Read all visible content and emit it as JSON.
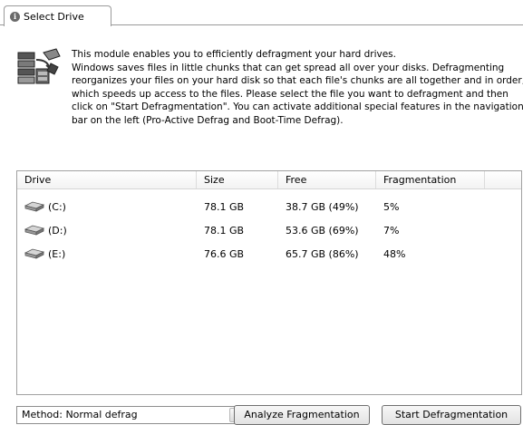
{
  "tab": {
    "label": "Select Drive",
    "icon": "info-icon"
  },
  "intro": {
    "icon": "defrag-module-icon",
    "lines": [
      "This module enables you to efficiently defragment your hard drives.",
      "Windows saves files in little chunks that can get spread all over your disks. Defragmenting",
      "reorganizes your files on your hard disk so that each file's chunks are all together and in order,",
      "which speeds up access to the files. Please select the file you want to defragment and then",
      "click on \"Start Defragmentation\". You can activate additional special features in the navigation",
      "bar on the left (Pro-Active Defrag and Boot-Time Defrag)."
    ]
  },
  "table": {
    "columns": [
      "Drive",
      "Size",
      "Free",
      "Fragmentation"
    ],
    "rows": [
      {
        "drive": "(C:)",
        "size": "78.1 GB",
        "free": "38.7 GB (49%)",
        "fragmentation": "5%"
      },
      {
        "drive": "(D:)",
        "size": "78.1 GB",
        "free": "53.6 GB (69%)",
        "fragmentation": "7%"
      },
      {
        "drive": "(E:)",
        "size": "76.6 GB",
        "free": "65.7 GB (86%)",
        "fragmentation": "48%"
      }
    ],
    "row_icon": "hard-disk-icon"
  },
  "footer": {
    "method_select": "Method: Normal defrag",
    "analyze_button": "Analyze Fragmentation",
    "start_button": "Start Defragmentation"
  }
}
